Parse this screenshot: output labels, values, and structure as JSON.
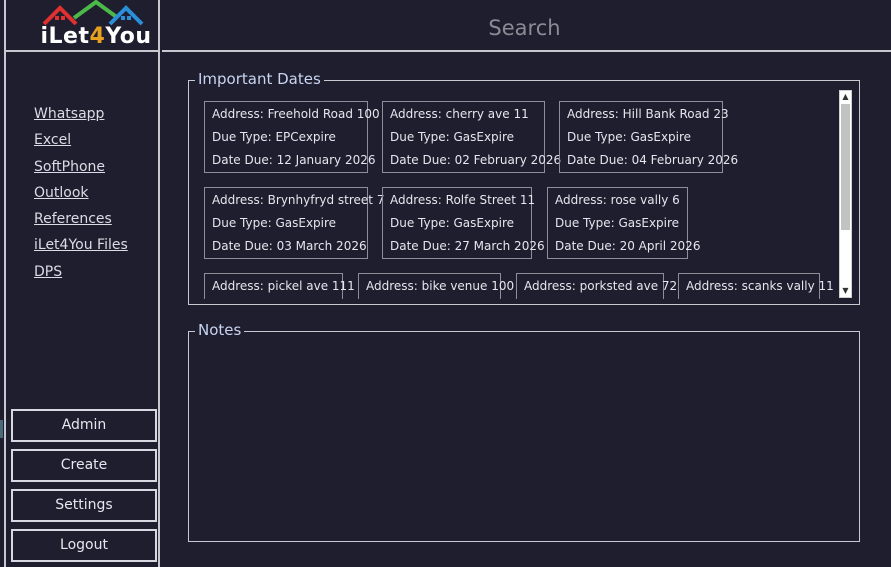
{
  "logo": {
    "text_main": "iLet",
    "text_four": "4",
    "text_end": "You"
  },
  "header": {
    "search_placeholder": "Search"
  },
  "nav": {
    "links": [
      "Whatsapp",
      "Excel",
      "SoftPhone",
      "Outlook",
      "References",
      "iLet4You Files",
      "DPS"
    ]
  },
  "sidebar_buttons": {
    "admin": "Admin",
    "create": "Create",
    "settings": "Settings",
    "logout": "Logout"
  },
  "important_dates": {
    "title": "Important Dates",
    "cards": [
      {
        "address": "Address: Freehold Road 100",
        "due_type": "Due Type: EPCexpire",
        "date_due": "Date Due: 12 January 2026"
      },
      {
        "address": "Address: cherry ave 11",
        "due_type": "Due Type: GasExpire",
        "date_due": "Date Due: 02 February 2026"
      },
      {
        "address": "Address: Hill Bank Road 23",
        "due_type": "Due Type: GasExpire",
        "date_due": "Date Due: 04 February 2026"
      },
      {
        "address": "Address: Brynhyfryd street 7",
        "due_type": "Due Type: GasExpire",
        "date_due": "Date Due: 03 March 2026"
      },
      {
        "address": "Address: Rolfe Street 11",
        "due_type": "Due Type: GasExpire",
        "date_due": "Date Due: 27 March 2026"
      },
      {
        "address": "Address: rose vally 6",
        "due_type": "Due Type: GasExpire",
        "date_due": "Date Due: 20 April 2026"
      },
      {
        "address": "Address: pickel ave 111"
      },
      {
        "address": "Address: bike venue 100"
      },
      {
        "address": "Address: porksted ave 72"
      },
      {
        "address": "Address: scanks vally 11"
      }
    ]
  },
  "notes": {
    "title": "Notes"
  },
  "colors": {
    "background": "#1e1e2e",
    "border": "#c8c8d0",
    "legend": "#c8d4f0",
    "logo_accent": "#e8a020"
  },
  "icons": {
    "scroll_up": "scroll-up-arrow-icon",
    "scroll_down": "scroll-down-arrow-icon"
  }
}
